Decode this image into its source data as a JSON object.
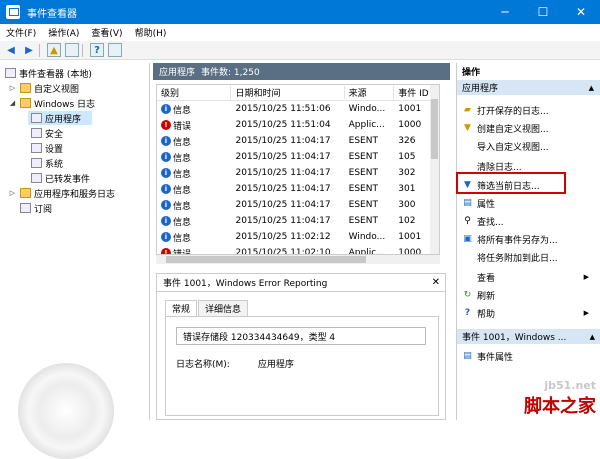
{
  "window": {
    "title": "事件查看器",
    "minimize": "─",
    "maximize": "☐",
    "close": "✕"
  },
  "menu": [
    "文件(F)",
    "操作(A)",
    "查看(V)",
    "帮助(H)"
  ],
  "tree": {
    "root": "事件查看器 (本地)",
    "custom_views": "自定义视图",
    "windows_logs": "Windows 日志",
    "application": "应用程序",
    "security": "安全",
    "setup": "设置",
    "system": "系统",
    "forwarded": "已转发事件",
    "apps_services": "应用程序和服务日志",
    "subscriptions": "订阅"
  },
  "center": {
    "log_name": "应用程序",
    "event_count": "事件数: 1,250",
    "columns": [
      "级别",
      "日期和时间",
      "来源",
      "事件 ID"
    ],
    "rows": [
      {
        "level": "信息",
        "type": "info",
        "date": "2015/10/25 11:51:06",
        "source": "Windo...",
        "id": "1001"
      },
      {
        "level": "错误",
        "type": "error",
        "date": "2015/10/25 11:51:04",
        "source": "Applic...",
        "id": "1000"
      },
      {
        "level": "信息",
        "type": "info",
        "date": "2015/10/25 11:04:17",
        "source": "ESENT",
        "id": "326"
      },
      {
        "level": "信息",
        "type": "info",
        "date": "2015/10/25 11:04:17",
        "source": "ESENT",
        "id": "105"
      },
      {
        "level": "信息",
        "type": "info",
        "date": "2015/10/25 11:04:17",
        "source": "ESENT",
        "id": "302"
      },
      {
        "level": "信息",
        "type": "info",
        "date": "2015/10/25 11:04:17",
        "source": "ESENT",
        "id": "301"
      },
      {
        "level": "信息",
        "type": "info",
        "date": "2015/10/25 11:04:17",
        "source": "ESENT",
        "id": "300"
      },
      {
        "level": "信息",
        "type": "info",
        "date": "2015/10/25 11:04:17",
        "source": "ESENT",
        "id": "102"
      },
      {
        "level": "信息",
        "type": "info",
        "date": "2015/10/25 11:02:12",
        "source": "Windo...",
        "id": "1001"
      },
      {
        "level": "错误",
        "type": "error",
        "date": "2015/10/25 11:02:10",
        "source": "Applic...",
        "id": "1000"
      }
    ],
    "detail_title": "事件 1001，Windows Error Reporting",
    "tabs": [
      "常规",
      "详细信息"
    ],
    "detail_text": "错误存储段 120334434649，类型 4",
    "log_name_label": "日志名称(M):",
    "log_name_value": "应用程序"
  },
  "actions": {
    "header": "操作",
    "section1": "应用程序",
    "items": [
      "打开保存的日志...",
      "创建自定义视图...",
      "导入自定义视图...",
      "清除日志...",
      "筛选当前日志...",
      "属性",
      "查找...",
      "将所有事件另存为...",
      "将任务附加到此日...",
      "查看",
      "刷新",
      "帮助"
    ],
    "section2": "事件 1001，Windows ...",
    "event_props": "事件属性"
  },
  "watermark": {
    "site": "jb51.net",
    "brand": "脚本之家"
  },
  "colors": {
    "titlebar": "#0078d7",
    "highlight": "#d60000",
    "section": "#d6e6f5"
  }
}
